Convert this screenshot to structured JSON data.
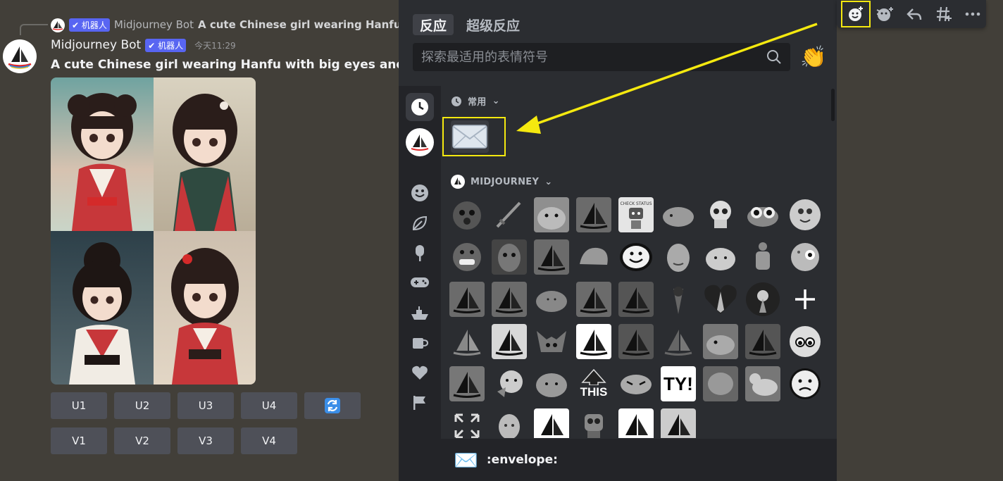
{
  "reply": {
    "bot_badge": "✔ 机器人",
    "author": "Midjourney Bot",
    "text": "A cute Chinese girl wearing Hanfu w"
  },
  "message": {
    "author": "Midjourney Bot",
    "bot_badge": "✔ 机器人",
    "time": "今天11:29",
    "prompt": "A cute Chinese girl wearing Hanfu with big eyes and blac"
  },
  "buttons": {
    "row1": [
      "U1",
      "U2",
      "U3",
      "U4"
    ],
    "row2": [
      "V1",
      "V2",
      "V3",
      "V4"
    ],
    "reroll_icon": "reroll-icon"
  },
  "toolbar": {
    "icons": [
      "add-reaction-icon",
      "super-reaction-icon",
      "reply-icon",
      "create-thread-icon",
      "more-icon"
    ]
  },
  "picker": {
    "tabs": [
      "反应",
      "超级反应"
    ],
    "search_placeholder": "探索最适用的表情符号",
    "skin_tone_emoji": "👏",
    "sections": {
      "frequent": "常用",
      "server": "MIDJOURNEY"
    },
    "sidebar_icons": [
      "clock-icon",
      "midjourney-server-icon",
      "smiley-icon",
      "leaf-icon",
      "popsicle-icon",
      "gamepad-icon",
      "boat-icon",
      "coffee-icon",
      "heart-icon",
      "flag-icon"
    ],
    "footer": {
      "emoji": "✉️",
      "name": ":envelope:"
    },
    "custom_labels": {
      "check_status": "CHECK STATUS",
      "this": "THIS",
      "ty": "TY!"
    },
    "colors": {
      "accent": "#5865f2",
      "highlight": "#f5e90f"
    }
  }
}
